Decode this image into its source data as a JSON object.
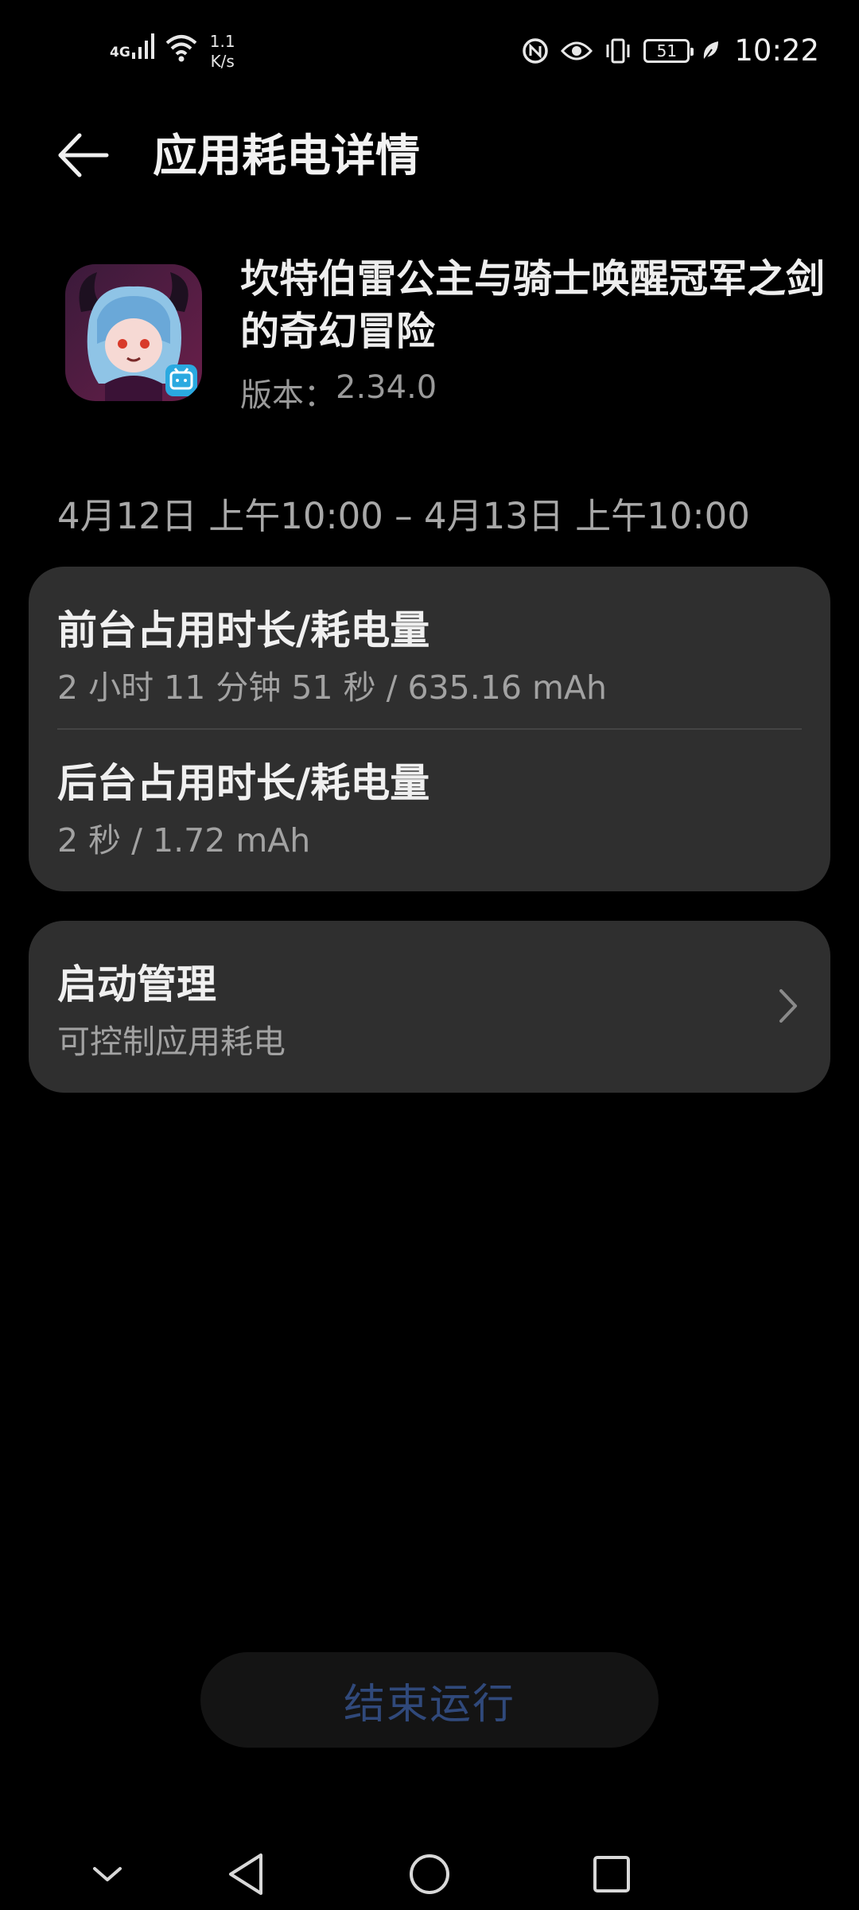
{
  "status_bar": {
    "network_type": "4G",
    "speed_value": "1.1",
    "speed_unit": "K/s",
    "battery_level": "51",
    "time": "10:22",
    "icons": [
      "signal-icon",
      "wifi-icon",
      "nfc-icon",
      "eye-comfort-icon",
      "vibrate-icon",
      "battery-icon",
      "leaf-icon"
    ]
  },
  "header": {
    "title": "应用耗电详情",
    "back_icon": "back-arrow-icon"
  },
  "app": {
    "name": "坎特伯雷公主与骑士唤醒冠军之剑的奇幻冒险",
    "version_label": "版本：",
    "version_value": "2.34.0"
  },
  "date_range": "4月12日 上午10:00 – 4月13日 上午10:00",
  "usage_card": {
    "foreground_title": "前台占用时长/耗电量",
    "foreground_value": "2 小时 11 分钟 51 秒 / 635.16 mAh",
    "background_title": "后台占用时长/耗电量",
    "background_value": "2 秒 / 1.72 mAh"
  },
  "startup_card": {
    "title": "启动管理",
    "subtitle": "可控制应用耗电",
    "icon": "chevron-right-icon"
  },
  "end_button": {
    "label": "结束运行"
  },
  "nav_bar": {
    "icons": [
      "hide-keyboard-icon",
      "back-icon",
      "home-icon",
      "recents-icon"
    ]
  },
  "colors": {
    "background": "#000000",
    "card": "#2f2f2f",
    "primary_text": "#f0f0f0",
    "secondary_text": "#a2a2a2",
    "end_button_text": "#30497b"
  }
}
